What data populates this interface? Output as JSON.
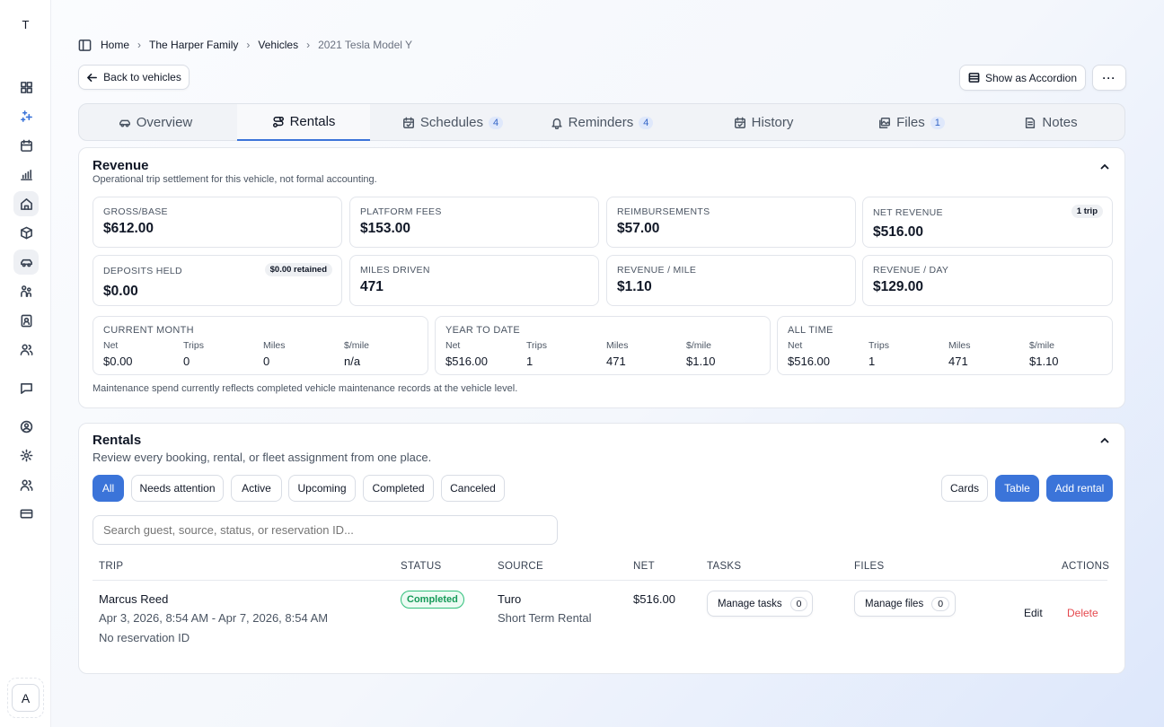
{
  "rail": {
    "logo": "T",
    "avatar": "A",
    "icons": [
      "dashboard-icon",
      "sparkles-icon",
      "calendar-icon",
      "chart-icon",
      "home-icon",
      "box-icon",
      "car-icon",
      "family-icon",
      "contact-icon",
      "users-icon",
      "chat-icon",
      "account-icon",
      "settings-icon",
      "team-icon",
      "billing-icon"
    ]
  },
  "breadcrumb": {
    "home": "Home",
    "family": "The Harper Family",
    "vehicles": "Vehicles",
    "current": "2021 Tesla Model Y"
  },
  "toolbar": {
    "back": "Back to vehicles",
    "accordion": "Show as Accordion"
  },
  "tabs": [
    {
      "label": "Overview"
    },
    {
      "label": "Rentals"
    },
    {
      "label": "Schedules",
      "count": "4"
    },
    {
      "label": "Reminders",
      "count": "4"
    },
    {
      "label": "History"
    },
    {
      "label": "Files",
      "count": "1"
    },
    {
      "label": "Notes"
    }
  ],
  "revenue": {
    "title": "Revenue",
    "subtitle": "Operational trip settlement for this vehicle, not formal accounting.",
    "stats": [
      {
        "label": "GROSS/BASE",
        "value": "$612.00"
      },
      {
        "label": "PLATFORM FEES",
        "value": "$153.00"
      },
      {
        "label": "REIMBURSEMENTS",
        "value": "$57.00"
      },
      {
        "label": "NET REVENUE",
        "value": "$516.00",
        "pill": "1 trip"
      },
      {
        "label": "DEPOSITS HELD",
        "value": "$0.00",
        "pill": "$0.00 retained"
      },
      {
        "label": "MILES DRIVEN",
        "value": "471"
      },
      {
        "label": "REVENUE / MILE",
        "value": "$1.10"
      },
      {
        "label": "REVENUE / DAY",
        "value": "$129.00"
      }
    ],
    "keys": {
      "net": "Net",
      "trips": "Trips",
      "miles": "Miles",
      "per_mile": "$/mile"
    },
    "summaries": [
      {
        "label": "CURRENT MONTH",
        "net": "$0.00",
        "trips": "0",
        "miles": "0",
        "per_mile": "n/a"
      },
      {
        "label": "YEAR TO DATE",
        "net": "$516.00",
        "trips": "1",
        "miles": "471",
        "per_mile": "$1.10"
      },
      {
        "label": "ALL TIME",
        "net": "$516.00",
        "trips": "1",
        "miles": "471",
        "per_mile": "$1.10"
      }
    ],
    "note": "Maintenance spend currently reflects completed vehicle maintenance records at the vehicle level."
  },
  "rentals": {
    "title": "Rentals",
    "subtitle": "Review every booking, rental, or fleet assignment from one place.",
    "filters": [
      "All",
      "Needs attention",
      "Active",
      "Upcoming",
      "Completed",
      "Canceled"
    ],
    "view": {
      "cards": "Cards",
      "table": "Table",
      "add": "Add rental"
    },
    "search_placeholder": "Search guest, source, status, or reservation ID...",
    "columns": {
      "trip": "TRIP",
      "status": "STATUS",
      "source": "SOURCE",
      "net": "NET",
      "tasks": "TASKS",
      "files": "FILES",
      "actions": "ACTIONS"
    },
    "rows": [
      {
        "guest": "Marcus Reed",
        "dates": "Apr 3, 2026, 8:54 AM - Apr 7, 2026, 8:54 AM",
        "reservation": "No reservation ID",
        "status": "Completed",
        "source": "Turo",
        "source_type": "Short Term Rental",
        "net": "$516.00",
        "tasks_label": "Manage tasks",
        "tasks_count": "0",
        "files_label": "Manage files",
        "files_count": "0",
        "edit": "Edit",
        "delete": "Delete"
      }
    ]
  },
  "colors": {
    "accent": "#3b74d9",
    "success": "#159a58",
    "danger": "#e5484d"
  }
}
